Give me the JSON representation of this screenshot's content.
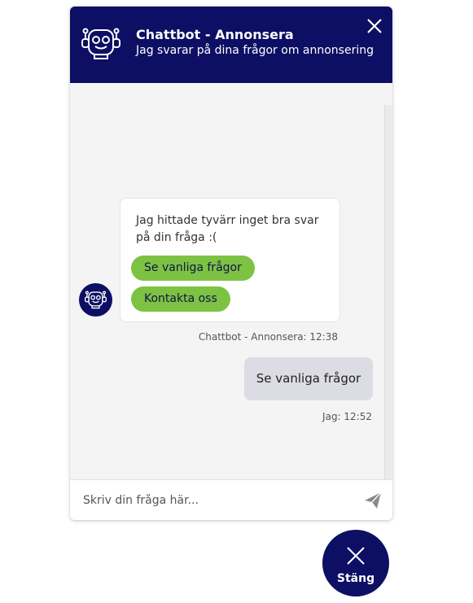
{
  "header": {
    "title": "Chattbot - Annonsera",
    "subtitle": "Jag svarar på dina frågor om annonsering",
    "icon": "robot-icon",
    "close_icon": "close-icon"
  },
  "messages": [
    {
      "sender": "bot",
      "text": "Jag hittade tyvärr inget bra svar på din fråga :(",
      "quick_replies": [
        "Se vanliga frågor",
        "Kontakta oss"
      ],
      "meta": "Chattbot - Annonsera: 12:38"
    },
    {
      "sender": "user",
      "text": "Se vanliga frågor",
      "meta": "Jag: 12:52"
    }
  ],
  "input": {
    "placeholder": "Skriv din fråga här...",
    "value": "",
    "send_icon": "send-icon"
  },
  "fab": {
    "label": "Stäng",
    "icon": "close-icon"
  },
  "colors": {
    "brand": "#0c0f63",
    "chip": "#7dc242",
    "user_bubble": "#dcdce4",
    "chat_bg": "#f4f4f4"
  }
}
